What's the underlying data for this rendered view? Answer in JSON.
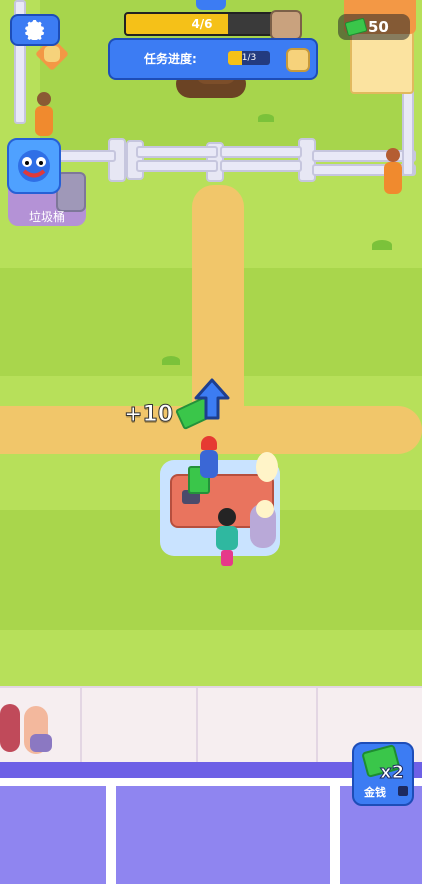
{
  "hud": {
    "level_progress": "4/6",
    "level_progress_fraction": 0.67,
    "money_value": "50",
    "money_icon": "cash-icon",
    "settings_icon": "gear-icon"
  },
  "task_panel": {
    "label": "任务进度:",
    "progress": "1/3",
    "progress_fraction": 0.33,
    "reward_icon": "bread-icon"
  },
  "trash": {
    "label": "垃圾桶"
  },
  "floating_reward": {
    "text": "+10"
  },
  "boost_button": {
    "multiplier": "x2",
    "label": "金钱"
  },
  "colors": {
    "accent_blue": "#3c7cf3",
    "money_green": "#3ac64a",
    "progress_yellow": "#f5c118"
  }
}
